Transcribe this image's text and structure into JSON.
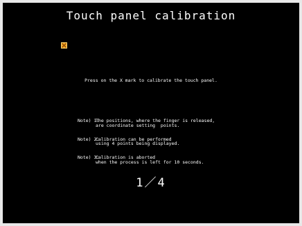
{
  "title": "Touch panel calibration",
  "instruction": "Press on the X mark to calibrate the touch panel.",
  "notes": [
    {
      "key": "Note) 1:",
      "lines": [
        "The positions, where the finger is released,",
        "are coordinate setting  points."
      ]
    },
    {
      "key": "Note) 2:",
      "lines": [
        "Calibration can be performed",
        "using 4 points being displayed."
      ]
    },
    {
      "key": "Note) 3:",
      "lines": [
        "Calibration is aborted",
        "when the process is left for 10 seconds."
      ]
    }
  ],
  "progress": {
    "current": "1",
    "separator": "／",
    "total": "4"
  },
  "target_icon": "x-mark-icon",
  "colors": {
    "background": "#000000",
    "text": "#ffffff",
    "target": "#f0a020"
  }
}
